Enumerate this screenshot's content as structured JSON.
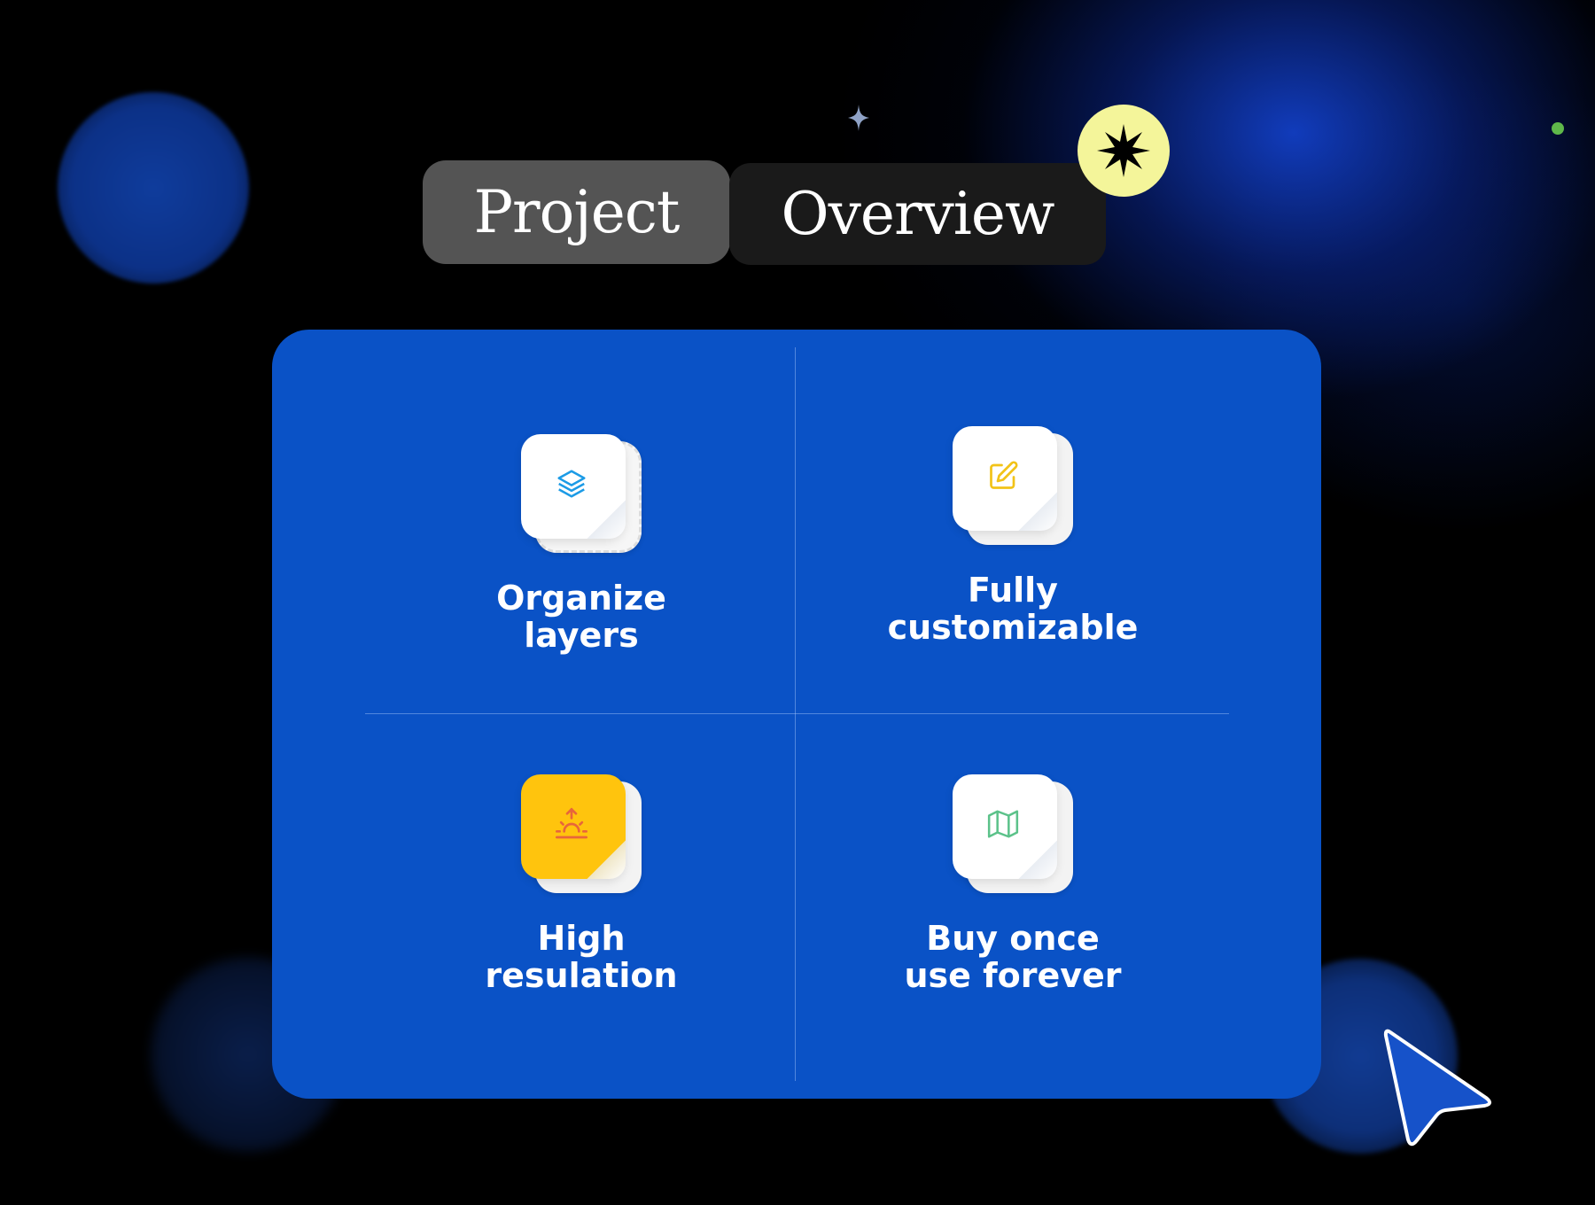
{
  "header": {
    "title_part1": "Project",
    "title_part2": "Overview",
    "badge_icon": "asterisk-burst-icon"
  },
  "features": [
    {
      "label_line1": "Organize",
      "label_line2": "layers",
      "icon": "layers-icon",
      "icon_color": "#1c9be6"
    },
    {
      "label_line1": "Fully",
      "label_line2": "customizable",
      "icon": "edit-icon",
      "icon_color": "#f2c318"
    },
    {
      "label_line1": "High",
      "label_line2": "resulation",
      "icon": "sunrise-icon",
      "icon_color": "#e8663a"
    },
    {
      "label_line1": "Buy once",
      "label_line2": "use forever",
      "icon": "map-icon",
      "icon_color": "#5cc28a"
    }
  ],
  "colors": {
    "background": "#000000",
    "card": "#0a52c6",
    "pill_project": "#545454",
    "pill_overview": "#1a1a1a",
    "badge": "#f4f59a",
    "accent_yellow": "#ffc40d",
    "cursor": "#1652c9",
    "dot": "#5fb84a"
  },
  "decor": {
    "cursor_icon": "pointer-cursor-icon",
    "sparkle_icon": "sparkle-icon"
  }
}
